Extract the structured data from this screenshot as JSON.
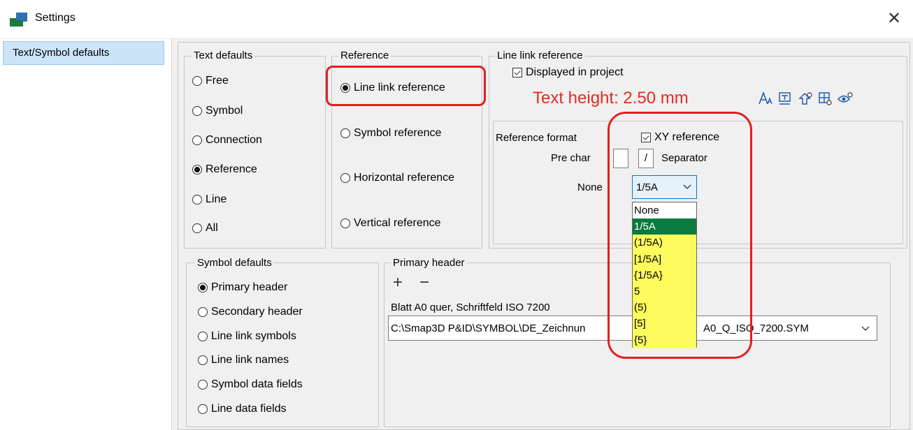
{
  "window": {
    "title": "Settings",
    "close_glyph": "✕"
  },
  "nav": {
    "items": [
      {
        "label": "Text/Symbol defaults"
      }
    ]
  },
  "text_defaults": {
    "legend": "Text defaults",
    "options": [
      {
        "label": "Free",
        "checked": false
      },
      {
        "label": "Symbol",
        "checked": false
      },
      {
        "label": "Connection",
        "checked": false
      },
      {
        "label": "Reference",
        "checked": true
      },
      {
        "label": "Line",
        "checked": false
      },
      {
        "label": "All",
        "checked": false
      }
    ]
  },
  "reference": {
    "legend": "Reference",
    "options": [
      {
        "label": "Line link reference",
        "checked": true
      },
      {
        "label": "Symbol reference",
        "checked": false
      },
      {
        "label": "Horizontal reference",
        "checked": false
      },
      {
        "label": "Vertical reference",
        "checked": false
      }
    ]
  },
  "line_link_reference": {
    "legend": "Line link reference",
    "displayed_label": "Displayed in project",
    "displayed_checked": true,
    "text_height": "Text height: 2.50 mm",
    "text_height_color": "#e52b20",
    "toolbar_icons": [
      "font-size-icon",
      "text-frame-icon",
      "symbol-settings-icon",
      "grid-settings-icon",
      "visibility-settings-icon"
    ]
  },
  "reference_format": {
    "label": "Reference format",
    "xy_label": "XY reference",
    "xy_checked": true,
    "pre_char_label": "Pre char",
    "pre_char_value": "",
    "separator_value": "/",
    "separator_label": "Separator",
    "none_label": "None",
    "combo_value": "1/5A",
    "options": [
      "None",
      "1/5A",
      "(1/5A)",
      "[1/5A]",
      "{1/5A}",
      "5",
      "(5)",
      "[5]",
      "{5}"
    ],
    "selected_index": 1
  },
  "symbol_defaults": {
    "legend": "Symbol defaults",
    "options": [
      {
        "label": "Primary header",
        "checked": true
      },
      {
        "label": "Secondary header",
        "checked": false
      },
      {
        "label": "Line link symbols",
        "checked": false
      },
      {
        "label": "Line link names",
        "checked": false
      },
      {
        "label": "Symbol data fields",
        "checked": false
      },
      {
        "label": "Line data fields",
        "checked": false
      }
    ]
  },
  "primary_header": {
    "legend": "Primary header",
    "add_glyph": "+",
    "remove_glyph": "−",
    "sheet_label": "Blatt A0 quer, Schriftfeld ISO 7200",
    "path_left": "C:\\Smap3D P&ID\\SYMBOL\\DE_Zeichnun",
    "path_right": "A0_Q_ISO_7200.SYM"
  },
  "colors": {
    "highlight_red": "#e02020",
    "dropdown_yellow": "#fdfb5e",
    "selected_green": "#0a7a3e",
    "nav_selected": "#cce4f7"
  }
}
